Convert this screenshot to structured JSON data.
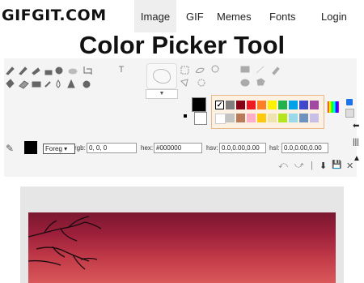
{
  "nav": {
    "logo": "GIFGIT.COM",
    "items": [
      {
        "label": "Image",
        "active": true
      },
      {
        "label": "GIF"
      },
      {
        "label": "Memes"
      },
      {
        "label": "Fonts"
      },
      {
        "label": "Login"
      }
    ]
  },
  "page_title": "Color Picker Tool",
  "toolbar": {
    "text_tool_glyph": "T"
  },
  "palette": {
    "row1": [
      "#000000",
      "#7f7f7f",
      "#880015",
      "#ed1c24",
      "#ff7f27",
      "#fff200",
      "#22b14c",
      "#00a2e8",
      "#3f48cc",
      "#a349a4"
    ],
    "row2": [
      "#ffffff",
      "#c3c3c3",
      "#b97a57",
      "#ffaec9",
      "#ffc90e",
      "#efe4b0",
      "#b5e61d",
      "#99d9ea",
      "#7092be",
      "#c8bfe7"
    ],
    "selected_glyph": "✓"
  },
  "color_panel": {
    "mode_select": "Foreg ▾",
    "rgb_label": "rgb:",
    "rgb_value": "0, 0, 0",
    "hex_label": "hex:",
    "hex_value": "#000000",
    "hsv_label": "hsv:",
    "hsv_value": "0.0,0.00,0.00",
    "hsl_label": "hsl:",
    "hsl_value": "0.0,0.00,0.00"
  },
  "shape_dropdown_glyph": "▼",
  "history": {
    "undo": "⤺",
    "redo": "⤻",
    "sep": "|",
    "download": "⬇",
    "save": "💾",
    "close": "✕"
  },
  "colors": {
    "accent": "#1a73e8",
    "palette_border": "#e7b98a"
  }
}
